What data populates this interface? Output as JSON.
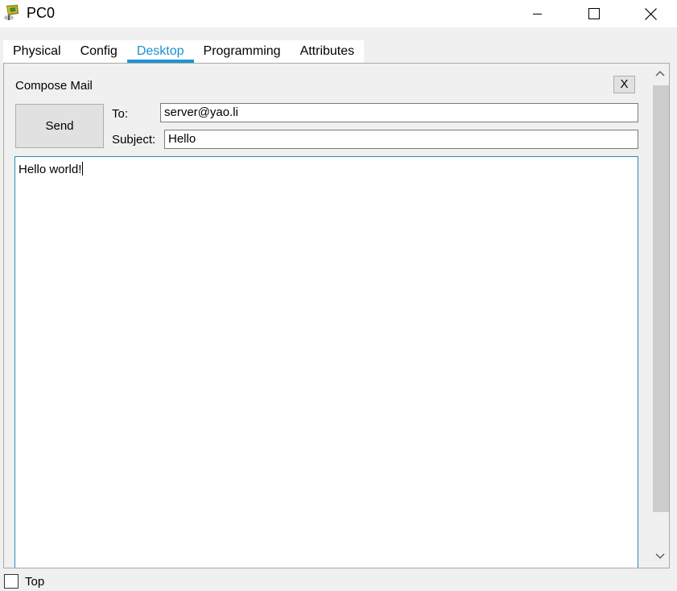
{
  "window": {
    "title": "PC0",
    "icon": "pc-icon",
    "controls": [
      "minimize-icon",
      "maximize-icon",
      "close-icon"
    ]
  },
  "tabs": [
    {
      "label": "Physical",
      "active": false
    },
    {
      "label": "Config",
      "active": false
    },
    {
      "label": "Desktop",
      "active": true
    },
    {
      "label": "Programming",
      "active": false
    },
    {
      "label": "Attributes",
      "active": false
    }
  ],
  "compose": {
    "title": "Compose Mail",
    "close_label": "X",
    "send_label": "Send",
    "to_label": "To:",
    "to_value": "server@yao.li",
    "subject_label": "Subject:",
    "subject_value": "Hello",
    "body": "Hello world!"
  },
  "footer": {
    "top_label": "Top",
    "top_checked": false
  },
  "colors": {
    "accent": "#1e95d4",
    "body_border": "#2a8ab8",
    "window_bg": "#f0f0f0"
  }
}
